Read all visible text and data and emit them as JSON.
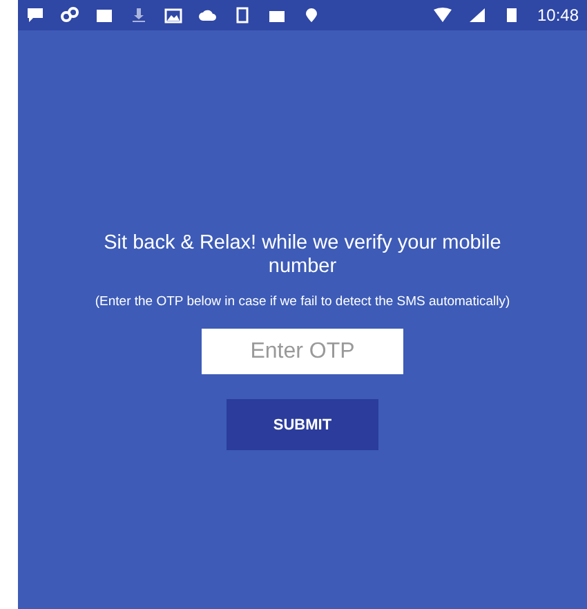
{
  "status_bar": {
    "time": "10:48"
  },
  "heading": "Sit back & Relax! while we verify your mobile number",
  "note": "(Enter the OTP below in case if we fail to detect the SMS automatically)",
  "otp_field": {
    "placeholder": "Enter OTP"
  },
  "submit_button": "SUBMIT"
}
